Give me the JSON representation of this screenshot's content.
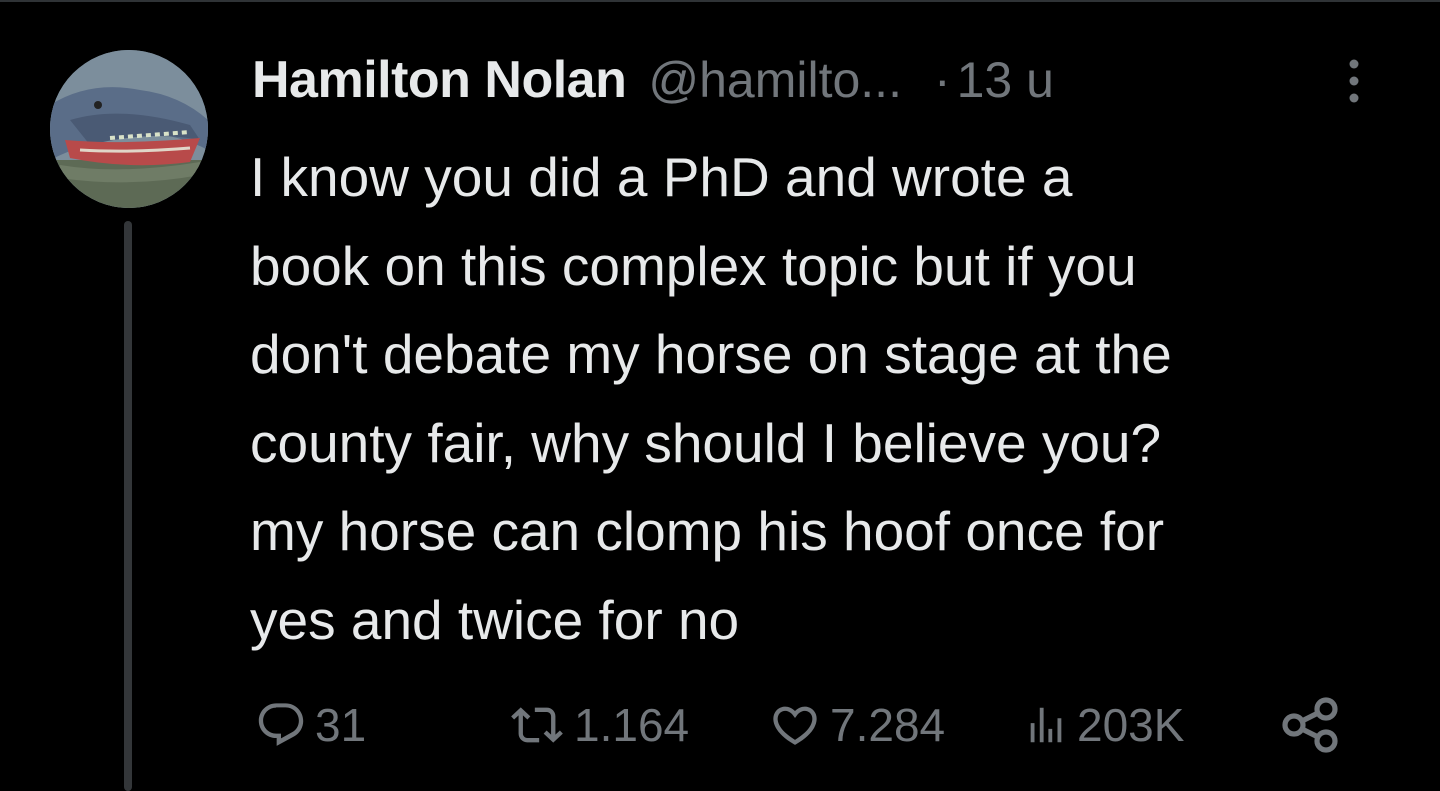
{
  "tweet": {
    "author_name": "Hamilton Nolan",
    "handle": "@hamilto...",
    "separator": "·",
    "time": "13 u",
    "avatar_icon": "alligator-avatar-icon",
    "text_lines": [
      "I know you did a PhD and wrote a",
      "book on this complex topic but if you",
      "don't debate my horse on stage at the",
      "county fair, why should I believe you?",
      "my horse can clomp his hoof once for",
      "yes and twice for no"
    ]
  },
  "actions": {
    "replies": {
      "icon": "reply-icon",
      "count": "31"
    },
    "reposts": {
      "icon": "repost-icon",
      "count": "1.164"
    },
    "likes": {
      "icon": "heart-icon",
      "count": "7.284"
    },
    "views": {
      "icon": "views-icon",
      "count": "203K"
    },
    "share": {
      "icon": "share-icon"
    }
  },
  "colors": {
    "background": "#000000",
    "text_primary": "#e7e9ea",
    "text_secondary": "#71767b",
    "thread_line": "#333639"
  }
}
